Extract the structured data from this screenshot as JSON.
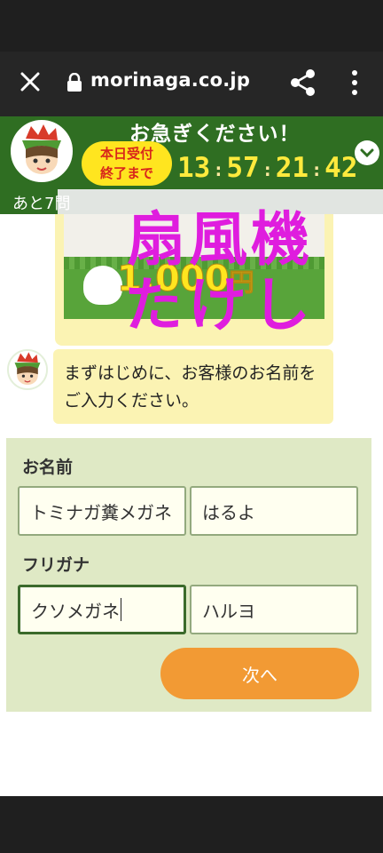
{
  "browser": {
    "domain": "morinaga.co.jp"
  },
  "banner": {
    "hurry": "お急ぎください！",
    "pill_line1": "本日受付",
    "pill_line2": "終了まで",
    "timer": {
      "h": "13",
      "m": "57",
      "s": "21",
      "cs": "42"
    },
    "colors": {
      "banner_bg": "#2f6e22",
      "pill_bg": "#ffe51f",
      "pill_text": "#d8261b",
      "timer_text": "#ffea3d"
    }
  },
  "progress": {
    "label": "あと7問",
    "fraction": 0.15
  },
  "promo": {
    "price_value": "1,000",
    "price_unit": "円"
  },
  "overlay": {
    "line1": "扇風機",
    "line2": "たけし"
  },
  "chat": {
    "message": "まずはじめに、お客様のお名前をご入力ください。"
  },
  "form": {
    "name_label": "お名前",
    "last_name": "トミナガ糞メガネ",
    "first_name": "はるよ",
    "furigana_label": "フリガナ",
    "last_kana": "クソメガネ",
    "first_kana": "ハルヨ",
    "next_label": "次へ"
  }
}
